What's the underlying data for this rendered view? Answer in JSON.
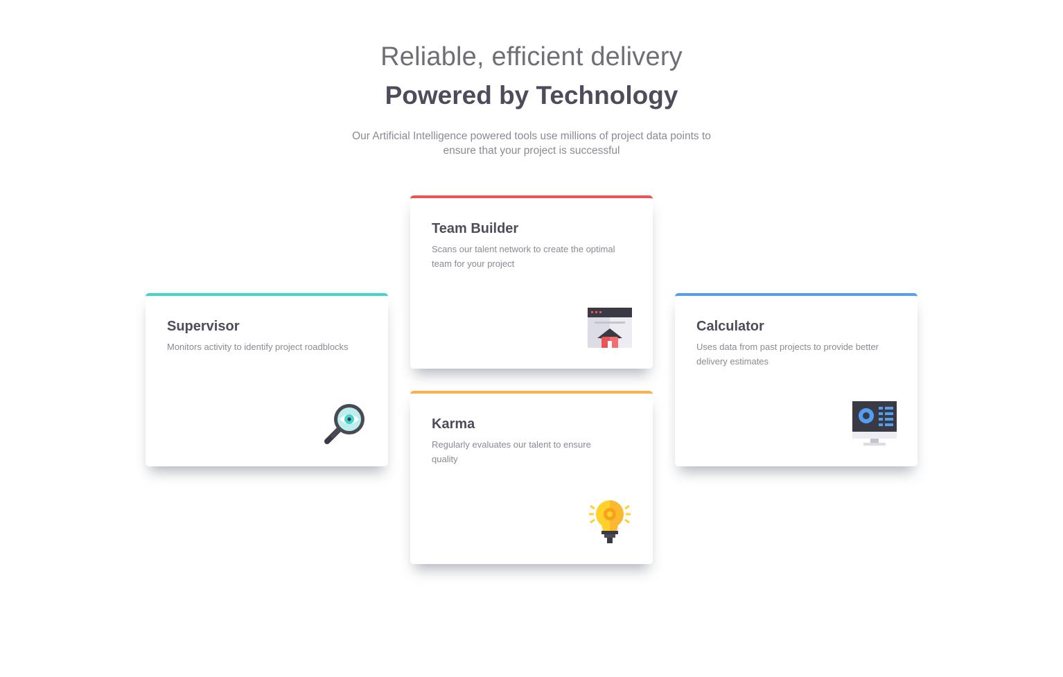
{
  "header": {
    "subtitle": "Reliable, efficient delivery",
    "title": "Powered by Technology",
    "intro": "Our Artificial Intelligence powered tools use millions of project data points to ensure that your project is successful"
  },
  "cards": [
    {
      "id": "supervisor",
      "title": "Supervisor",
      "description": "Monitors activity to identify project roadblocks",
      "accent": "#44d3d2",
      "icon": "magnifier-eye-icon"
    },
    {
      "id": "team_builder",
      "title": "Team Builder",
      "description": "Scans our talent network to create the optimal team for your project",
      "accent": "#ea5454",
      "icon": "browser-house-icon"
    },
    {
      "id": "karma",
      "title": "Karma",
      "description": "Regularly evaluates our talent to ensure quality",
      "accent": "#fcaf4a",
      "icon": "lightbulb-icon"
    },
    {
      "id": "calculator",
      "title": "Calculator",
      "description": "Uses data from past projects to provide better delivery estimates",
      "accent": "#549ef2",
      "icon": "monitor-chart-icon"
    }
  ]
}
